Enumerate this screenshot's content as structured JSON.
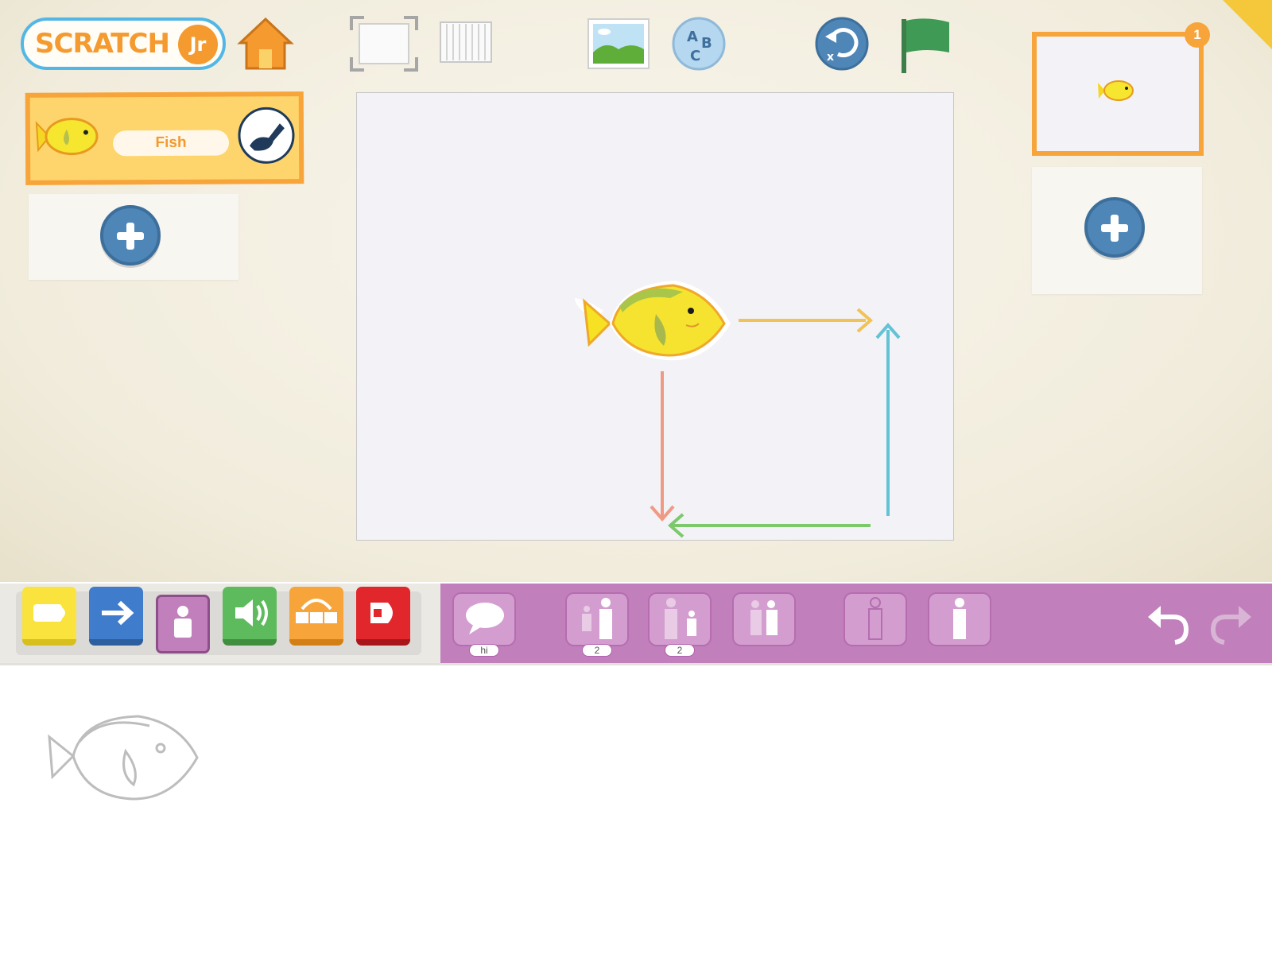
{
  "app": {
    "logo_text": "SCRATCH",
    "logo_suffix": "Jr"
  },
  "toolbar": {
    "icons": [
      "home-icon",
      "fullscreen-icon",
      "grid-icon",
      "background-icon",
      "text-icon",
      "reset-characters-icon",
      "green-flag-icon"
    ]
  },
  "sprites": {
    "items": [
      {
        "name": "Fish",
        "icon": "fish-icon"
      }
    ]
  },
  "pages": {
    "count_badge": "1"
  },
  "palette": {
    "categories": [
      {
        "name": "triggering",
        "color": "#f9de3a"
      },
      {
        "name": "motion",
        "color": "#3f7ccb"
      },
      {
        "name": "looks",
        "color": "#c17fbc"
      },
      {
        "name": "sound",
        "color": "#5dbb5d"
      },
      {
        "name": "control",
        "color": "#f7a53a"
      },
      {
        "name": "end",
        "color": "#e1262c"
      }
    ],
    "blocks": [
      {
        "name": "say",
        "label": "hi"
      },
      {
        "name": "grow",
        "label": "2"
      },
      {
        "name": "shrink",
        "label": "2"
      },
      {
        "name": "reset-size",
        "label": ""
      },
      {
        "name": "hide",
        "label": ""
      },
      {
        "name": "show",
        "label": ""
      }
    ]
  }
}
